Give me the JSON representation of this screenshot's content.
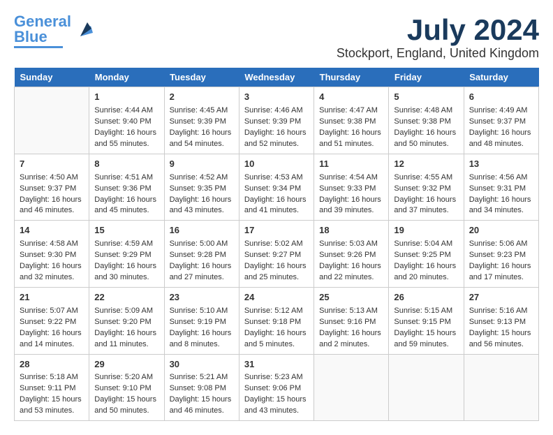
{
  "logo": {
    "line1": "General",
    "line2": "Blue"
  },
  "title": "July 2024",
  "subtitle": "Stockport, England, United Kingdom",
  "days_of_week": [
    "Sunday",
    "Monday",
    "Tuesday",
    "Wednesday",
    "Thursday",
    "Friday",
    "Saturday"
  ],
  "weeks": [
    [
      {
        "day": "",
        "empty": true
      },
      {
        "day": "1",
        "sunrise": "Sunrise: 4:44 AM",
        "sunset": "Sunset: 9:40 PM",
        "daylight": "Daylight: 16 hours and 55 minutes."
      },
      {
        "day": "2",
        "sunrise": "Sunrise: 4:45 AM",
        "sunset": "Sunset: 9:39 PM",
        "daylight": "Daylight: 16 hours and 54 minutes."
      },
      {
        "day": "3",
        "sunrise": "Sunrise: 4:46 AM",
        "sunset": "Sunset: 9:39 PM",
        "daylight": "Daylight: 16 hours and 52 minutes."
      },
      {
        "day": "4",
        "sunrise": "Sunrise: 4:47 AM",
        "sunset": "Sunset: 9:38 PM",
        "daylight": "Daylight: 16 hours and 51 minutes."
      },
      {
        "day": "5",
        "sunrise": "Sunrise: 4:48 AM",
        "sunset": "Sunset: 9:38 PM",
        "daylight": "Daylight: 16 hours and 50 minutes."
      },
      {
        "day": "6",
        "sunrise": "Sunrise: 4:49 AM",
        "sunset": "Sunset: 9:37 PM",
        "daylight": "Daylight: 16 hours and 48 minutes."
      }
    ],
    [
      {
        "day": "7",
        "sunrise": "Sunrise: 4:50 AM",
        "sunset": "Sunset: 9:37 PM",
        "daylight": "Daylight: 16 hours and 46 minutes."
      },
      {
        "day": "8",
        "sunrise": "Sunrise: 4:51 AM",
        "sunset": "Sunset: 9:36 PM",
        "daylight": "Daylight: 16 hours and 45 minutes."
      },
      {
        "day": "9",
        "sunrise": "Sunrise: 4:52 AM",
        "sunset": "Sunset: 9:35 PM",
        "daylight": "Daylight: 16 hours and 43 minutes."
      },
      {
        "day": "10",
        "sunrise": "Sunrise: 4:53 AM",
        "sunset": "Sunset: 9:34 PM",
        "daylight": "Daylight: 16 hours and 41 minutes."
      },
      {
        "day": "11",
        "sunrise": "Sunrise: 4:54 AM",
        "sunset": "Sunset: 9:33 PM",
        "daylight": "Daylight: 16 hours and 39 minutes."
      },
      {
        "day": "12",
        "sunrise": "Sunrise: 4:55 AM",
        "sunset": "Sunset: 9:32 PM",
        "daylight": "Daylight: 16 hours and 37 minutes."
      },
      {
        "day": "13",
        "sunrise": "Sunrise: 4:56 AM",
        "sunset": "Sunset: 9:31 PM",
        "daylight": "Daylight: 16 hours and 34 minutes."
      }
    ],
    [
      {
        "day": "14",
        "sunrise": "Sunrise: 4:58 AM",
        "sunset": "Sunset: 9:30 PM",
        "daylight": "Daylight: 16 hours and 32 minutes."
      },
      {
        "day": "15",
        "sunrise": "Sunrise: 4:59 AM",
        "sunset": "Sunset: 9:29 PM",
        "daylight": "Daylight: 16 hours and 30 minutes."
      },
      {
        "day": "16",
        "sunrise": "Sunrise: 5:00 AM",
        "sunset": "Sunset: 9:28 PM",
        "daylight": "Daylight: 16 hours and 27 minutes."
      },
      {
        "day": "17",
        "sunrise": "Sunrise: 5:02 AM",
        "sunset": "Sunset: 9:27 PM",
        "daylight": "Daylight: 16 hours and 25 minutes."
      },
      {
        "day": "18",
        "sunrise": "Sunrise: 5:03 AM",
        "sunset": "Sunset: 9:26 PM",
        "daylight": "Daylight: 16 hours and 22 minutes."
      },
      {
        "day": "19",
        "sunrise": "Sunrise: 5:04 AM",
        "sunset": "Sunset: 9:25 PM",
        "daylight": "Daylight: 16 hours and 20 minutes."
      },
      {
        "day": "20",
        "sunrise": "Sunrise: 5:06 AM",
        "sunset": "Sunset: 9:23 PM",
        "daylight": "Daylight: 16 hours and 17 minutes."
      }
    ],
    [
      {
        "day": "21",
        "sunrise": "Sunrise: 5:07 AM",
        "sunset": "Sunset: 9:22 PM",
        "daylight": "Daylight: 16 hours and 14 minutes."
      },
      {
        "day": "22",
        "sunrise": "Sunrise: 5:09 AM",
        "sunset": "Sunset: 9:20 PM",
        "daylight": "Daylight: 16 hours and 11 minutes."
      },
      {
        "day": "23",
        "sunrise": "Sunrise: 5:10 AM",
        "sunset": "Sunset: 9:19 PM",
        "daylight": "Daylight: 16 hours and 8 minutes."
      },
      {
        "day": "24",
        "sunrise": "Sunrise: 5:12 AM",
        "sunset": "Sunset: 9:18 PM",
        "daylight": "Daylight: 16 hours and 5 minutes."
      },
      {
        "day": "25",
        "sunrise": "Sunrise: 5:13 AM",
        "sunset": "Sunset: 9:16 PM",
        "daylight": "Daylight: 16 hours and 2 minutes."
      },
      {
        "day": "26",
        "sunrise": "Sunrise: 5:15 AM",
        "sunset": "Sunset: 9:15 PM",
        "daylight": "Daylight: 15 hours and 59 minutes."
      },
      {
        "day": "27",
        "sunrise": "Sunrise: 5:16 AM",
        "sunset": "Sunset: 9:13 PM",
        "daylight": "Daylight: 15 hours and 56 minutes."
      }
    ],
    [
      {
        "day": "28",
        "sunrise": "Sunrise: 5:18 AM",
        "sunset": "Sunset: 9:11 PM",
        "daylight": "Daylight: 15 hours and 53 minutes."
      },
      {
        "day": "29",
        "sunrise": "Sunrise: 5:20 AM",
        "sunset": "Sunset: 9:10 PM",
        "daylight": "Daylight: 15 hours and 50 minutes."
      },
      {
        "day": "30",
        "sunrise": "Sunrise: 5:21 AM",
        "sunset": "Sunset: 9:08 PM",
        "daylight": "Daylight: 15 hours and 46 minutes."
      },
      {
        "day": "31",
        "sunrise": "Sunrise: 5:23 AM",
        "sunset": "Sunset: 9:06 PM",
        "daylight": "Daylight: 15 hours and 43 minutes."
      },
      {
        "day": "",
        "empty": true
      },
      {
        "day": "",
        "empty": true
      },
      {
        "day": "",
        "empty": true
      }
    ]
  ]
}
